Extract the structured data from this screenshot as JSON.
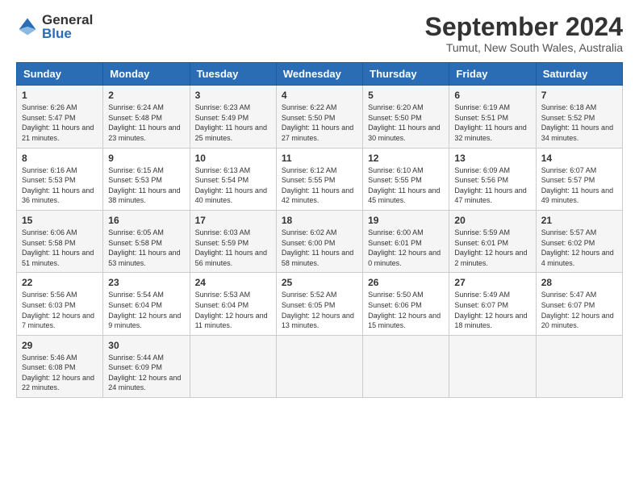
{
  "logo": {
    "general": "General",
    "blue": "Blue"
  },
  "title": "September 2024",
  "location": "Tumut, New South Wales, Australia",
  "days": [
    "Sunday",
    "Monday",
    "Tuesday",
    "Wednesday",
    "Thursday",
    "Friday",
    "Saturday"
  ],
  "weeks": [
    [
      {
        "num": "1",
        "rise": "6:26 AM",
        "set": "5:47 PM",
        "daylight": "11 hours and 21 minutes."
      },
      {
        "num": "2",
        "rise": "6:24 AM",
        "set": "5:48 PM",
        "daylight": "11 hours and 23 minutes."
      },
      {
        "num": "3",
        "rise": "6:23 AM",
        "set": "5:49 PM",
        "daylight": "11 hours and 25 minutes."
      },
      {
        "num": "4",
        "rise": "6:22 AM",
        "set": "5:50 PM",
        "daylight": "11 hours and 27 minutes."
      },
      {
        "num": "5",
        "rise": "6:20 AM",
        "set": "5:50 PM",
        "daylight": "11 hours and 30 minutes."
      },
      {
        "num": "6",
        "rise": "6:19 AM",
        "set": "5:51 PM",
        "daylight": "11 hours and 32 minutes."
      },
      {
        "num": "7",
        "rise": "6:18 AM",
        "set": "5:52 PM",
        "daylight": "11 hours and 34 minutes."
      }
    ],
    [
      {
        "num": "8",
        "rise": "6:16 AM",
        "set": "5:53 PM",
        "daylight": "11 hours and 36 minutes."
      },
      {
        "num": "9",
        "rise": "6:15 AM",
        "set": "5:53 PM",
        "daylight": "11 hours and 38 minutes."
      },
      {
        "num": "10",
        "rise": "6:13 AM",
        "set": "5:54 PM",
        "daylight": "11 hours and 40 minutes."
      },
      {
        "num": "11",
        "rise": "6:12 AM",
        "set": "5:55 PM",
        "daylight": "11 hours and 42 minutes."
      },
      {
        "num": "12",
        "rise": "6:10 AM",
        "set": "5:55 PM",
        "daylight": "11 hours and 45 minutes."
      },
      {
        "num": "13",
        "rise": "6:09 AM",
        "set": "5:56 PM",
        "daylight": "11 hours and 47 minutes."
      },
      {
        "num": "14",
        "rise": "6:07 AM",
        "set": "5:57 PM",
        "daylight": "11 hours and 49 minutes."
      }
    ],
    [
      {
        "num": "15",
        "rise": "6:06 AM",
        "set": "5:58 PM",
        "daylight": "11 hours and 51 minutes."
      },
      {
        "num": "16",
        "rise": "6:05 AM",
        "set": "5:58 PM",
        "daylight": "11 hours and 53 minutes."
      },
      {
        "num": "17",
        "rise": "6:03 AM",
        "set": "5:59 PM",
        "daylight": "11 hours and 56 minutes."
      },
      {
        "num": "18",
        "rise": "6:02 AM",
        "set": "6:00 PM",
        "daylight": "11 hours and 58 minutes."
      },
      {
        "num": "19",
        "rise": "6:00 AM",
        "set": "6:01 PM",
        "daylight": "12 hours and 0 minutes."
      },
      {
        "num": "20",
        "rise": "5:59 AM",
        "set": "6:01 PM",
        "daylight": "12 hours and 2 minutes."
      },
      {
        "num": "21",
        "rise": "5:57 AM",
        "set": "6:02 PM",
        "daylight": "12 hours and 4 minutes."
      }
    ],
    [
      {
        "num": "22",
        "rise": "5:56 AM",
        "set": "6:03 PM",
        "daylight": "12 hours and 7 minutes."
      },
      {
        "num": "23",
        "rise": "5:54 AM",
        "set": "6:04 PM",
        "daylight": "12 hours and 9 minutes."
      },
      {
        "num": "24",
        "rise": "5:53 AM",
        "set": "6:04 PM",
        "daylight": "12 hours and 11 minutes."
      },
      {
        "num": "25",
        "rise": "5:52 AM",
        "set": "6:05 PM",
        "daylight": "12 hours and 13 minutes."
      },
      {
        "num": "26",
        "rise": "5:50 AM",
        "set": "6:06 PM",
        "daylight": "12 hours and 15 minutes."
      },
      {
        "num": "27",
        "rise": "5:49 AM",
        "set": "6:07 PM",
        "daylight": "12 hours and 18 minutes."
      },
      {
        "num": "28",
        "rise": "5:47 AM",
        "set": "6:07 PM",
        "daylight": "12 hours and 20 minutes."
      }
    ],
    [
      {
        "num": "29",
        "rise": "5:46 AM",
        "set": "6:08 PM",
        "daylight": "12 hours and 22 minutes."
      },
      {
        "num": "30",
        "rise": "5:44 AM",
        "set": "6:09 PM",
        "daylight": "12 hours and 24 minutes."
      },
      null,
      null,
      null,
      null,
      null
    ]
  ]
}
